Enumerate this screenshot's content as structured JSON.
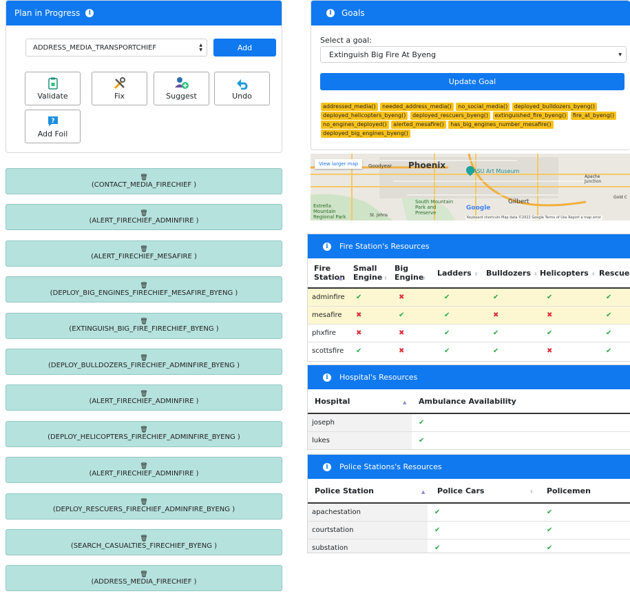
{
  "plan": {
    "title": "Plan in Progress",
    "select_value": "ADDRESS_MEDIA_TRANSPORTCHIEF",
    "add_label": "Add",
    "buttons": [
      "Validate",
      "Fix",
      "Suggest",
      "Undo",
      "Add Foil"
    ]
  },
  "actions": [
    "(CONTACT_MEDIA_FIRECHIEF )",
    "(ALERT_FIRECHIEF_ADMINFIRE )",
    "(ALERT_FIRECHIEF_MESAFIRE )",
    "(DEPLOY_BIG_ENGINES_FIRECHIEF_MESAFIRE_BYENG )",
    "(EXTINGUISH_BIG_FIRE_FIRECHIEF_BYENG )",
    "(DEPLOY_BULLDOZERS_FIRECHIEF_ADMINFIRE_BYENG )",
    "(ALERT_FIRECHIEF_ADMINFIRE )",
    "(DEPLOY_HELICOPTERS_FIRECHIEF_ADMINFIRE_BYENG )",
    "(ALERT_FIRECHIEF_ADMINFIRE )",
    "(DEPLOY_RESCUERS_FIRECHIEF_ADMINFIRE_BYENG )",
    "(SEARCH_CASUALTIES_FIRECHIEF_BYENG )",
    "(ADDRESS_MEDIA_FIRECHIEF )"
  ],
  "goals": {
    "title": "Goals",
    "select_label": "Select a goal:",
    "select_value": "Extinguish Big Fire At Byeng",
    "update_label": "Update Goal",
    "facts": [
      "addressed_media()",
      "needed_address_media()",
      "no_social_media()",
      "deployed_bulldozers_byeng()",
      "deployed_helicopters_byeng()",
      "deployed_rescuers_byeng()",
      "extinguished_fire_byeng()",
      "fire_at_byeng()",
      "no_engines_deployed()",
      "alerted_mesafire()",
      "has_big_engines_number_mesafire()",
      "deployed_big_engines_byeng()"
    ]
  },
  "map": {
    "larger_link": "View larger map",
    "places": [
      "Goodyear",
      "Phoenix",
      "ASU Art Museum",
      "Apache Junction",
      "Estrella Mountain Regional Park",
      "South Mountain Park and Preserve",
      "Gilbert",
      "St. Johns",
      "Gold C"
    ],
    "footer": "Keyboard shortcuts   Map data ©2022 Google   Terms of Use   Report a map error",
    "logo": "Google"
  },
  "fire": {
    "title": "Fire Station's Resources",
    "headers": [
      "Fire Station",
      "Small Engine",
      "Big Engine",
      "Ladders",
      "Bulldozers",
      "Helicopters",
      "Rescuers"
    ],
    "rows": [
      {
        "name": "adminfire",
        "vals": [
          true,
          false,
          true,
          true,
          true,
          true
        ]
      },
      {
        "name": "mesafire",
        "vals": [
          false,
          true,
          true,
          false,
          false,
          true
        ]
      },
      {
        "name": "phxfire",
        "vals": [
          false,
          false,
          true,
          true,
          true,
          true
        ]
      },
      {
        "name": "scottsfire",
        "vals": [
          true,
          false,
          true,
          true,
          false,
          true
        ]
      }
    ]
  },
  "hospital": {
    "title": "Hospital's Resources",
    "headers": [
      "Hospital",
      "Ambulance Availability"
    ],
    "rows": [
      {
        "name": "joseph",
        "vals": [
          true
        ]
      },
      {
        "name": "lukes",
        "vals": [
          true
        ]
      }
    ]
  },
  "police": {
    "title": "Police Stations's Resources",
    "headers": [
      "Police Station",
      "Police Cars",
      "Policemen"
    ],
    "rows": [
      {
        "name": "apachestation",
        "vals": [
          true,
          true
        ]
      },
      {
        "name": "courtstation",
        "vals": [
          true,
          true
        ]
      },
      {
        "name": "substation",
        "vals": [
          true,
          true
        ]
      }
    ]
  },
  "symbols": {
    "check": "✔",
    "cross": "✖",
    "trash": "🗑"
  },
  "colors": {
    "primary": "#1079ef",
    "action_bg": "#b6e2de",
    "fact_bg": "#f9c21a",
    "check": "#27a745",
    "cross": "#e02e3a"
  }
}
